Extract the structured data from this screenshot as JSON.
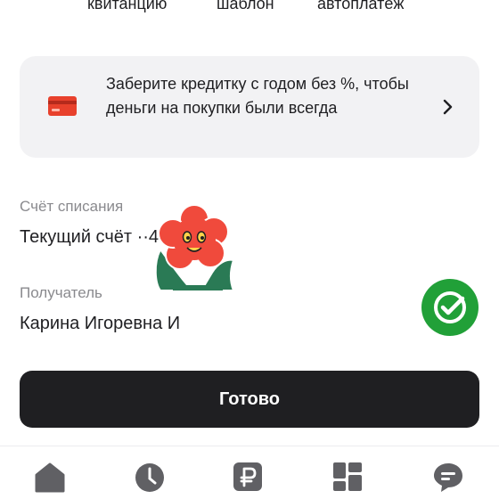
{
  "top_actions": {
    "receipt_label": "квитанцию",
    "template_label": "шаблон",
    "autopay_label": "автоплатёж"
  },
  "promo": {
    "text": "Заберите кредитку с годом без %, чтобы деньги на покупки были всегда",
    "icon": "credit-card-icon",
    "icon_color": "#e8412c"
  },
  "debit_account": {
    "label": "Счёт списания",
    "value": "Текущий счёт ··4"
  },
  "recipient": {
    "label": "Получатель",
    "value": "Карина Игоревна И"
  },
  "sticker": {
    "name": "flower-mascot",
    "petal_color": "#f04a3c",
    "leaf_color": "#2a7a55"
  },
  "fab": {
    "icon": "sber-check-icon",
    "color": "#21a038"
  },
  "done_button": {
    "label": "Готово",
    "color": "#1f1f22"
  },
  "tab_bar": {
    "icon_color": "#606064",
    "tabs": [
      {
        "icon": "home-icon"
      },
      {
        "icon": "history-clock-icon"
      },
      {
        "icon": "payments-ruble-icon"
      },
      {
        "icon": "showcase-grid-icon"
      },
      {
        "icon": "chat-bubble-icon"
      }
    ]
  }
}
